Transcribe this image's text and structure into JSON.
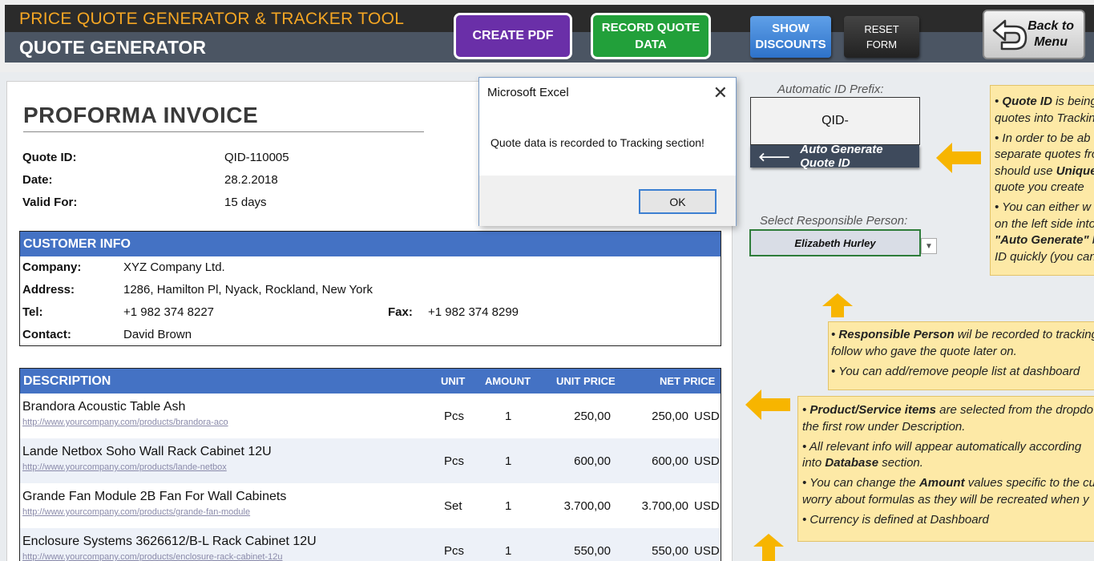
{
  "header": {
    "app_title": "PRICE QUOTE GENERATOR & TRACKER TOOL",
    "page_title": "QUOTE GENERATOR",
    "create_pdf": "CREATE PDF",
    "record_line1": "RECORD QUOTE",
    "record_line2": "DATA",
    "discounts_line1": "SHOW",
    "discounts_line2": "DISCOUNTS",
    "reset_line1": "RESET",
    "reset_line2": "FORM",
    "back_line1": "Back to",
    "back_line2": "Menu"
  },
  "invoice": {
    "title": "PROFORMA INVOICE",
    "meta": [
      {
        "label": "Quote ID:",
        "value": "QID-110005"
      },
      {
        "label": "Date:",
        "value": "28.2.2018"
      },
      {
        "label": "Valid For:",
        "value": "15 days"
      }
    ],
    "customer": {
      "heading": "CUSTOMER INFO",
      "company_label": "Company:",
      "company": "XYZ Company Ltd.",
      "address_label": "Address:",
      "address": "1286, Hamilton Pl, Nyack, Rockland, New York",
      "tel_label": "Tel:",
      "tel": "+1 982 374 8227",
      "fax_label": "Fax:",
      "fax": "+1 982 374 8299",
      "contact_label": "Contact:",
      "contact": "David Brown"
    },
    "items_header": {
      "description": "DESCRIPTION",
      "unit": "UNIT",
      "amount": "AMOUNT",
      "unit_price": "UNIT PRICE",
      "net_price": "NET PRICE"
    },
    "items": [
      {
        "name": "Brandora Acoustic Table Ash",
        "link": "http://www.yourcompany.com/products/brandora-aco",
        "unit": "Pcs",
        "amount": "1",
        "unit_price": "250,00",
        "net_price": "250,00",
        "currency": "USD"
      },
      {
        "name": "Lande Netbox Soho Wall Rack Cabinet 12U",
        "link": "http://www.yourcompany.com/products/lande-netbox",
        "unit": "Pcs",
        "amount": "1",
        "unit_price": "600,00",
        "net_price": "600,00",
        "currency": "USD"
      },
      {
        "name": "Grande Fan Module 2B Fan For Wall Cabinets",
        "link": "http://www.yourcompany.com/products/grande-fan-module",
        "unit": "Set",
        "amount": "1",
        "unit_price": "3.700,00",
        "net_price": "3.700,00",
        "currency": "USD"
      },
      {
        "name": "Enclosure Systems 3626612/B-L Rack Cabinet 12U",
        "link": "http://www.yourcompany.com/products/enclosure-rack-cabinet-12u",
        "unit": "Pcs",
        "amount": "1",
        "unit_price": "550,00",
        "net_price": "550,00",
        "currency": "USD"
      }
    ]
  },
  "dialog": {
    "title": "Microsoft Excel",
    "message": "Quote data is recorded to Tracking section!",
    "ok": "OK"
  },
  "side": {
    "prefix_label": "Automatic ID Prefix:",
    "prefix_value": "QID-",
    "auto_generate": "Auto Generate Quote ID",
    "person_label": "Select Responsible Person:",
    "person_value": "Elizabeth Hurley",
    "note1": {
      "l1_bold": "Quote ID",
      "l1_rest": " is being",
      "l2": "quotes into Trackin",
      "l3": "In order to be ab",
      "l4": "separate quotes fro",
      "l5_pre": "should use ",
      "l5_bold": "Unique",
      "l6": "quote you create",
      "l7": "You can either w",
      "l8": "on the left side into",
      "l9_bold": "\"Auto Generate\"",
      "l9_rest": " b",
      "l10": "ID quickly (you can"
    },
    "note2": {
      "l1_bold": "Responsible Person",
      "l1_rest": " wil be recorded to tracking",
      "l2": "follow who gave the quote later on.",
      "l3": "You can add/remove people list at dashboard"
    },
    "note3": {
      "l1_bold": "Product/Service items",
      "l1_rest": " are selected from the dropdo",
      "l2": "the first row under Description.",
      "l3": "All relevant info will appear automatically according",
      "l4_pre": "into ",
      "l4_bold": "Database",
      "l4_rest": " section.",
      "l5_pre": "You can change the ",
      "l5_bold": "Amount",
      "l5_rest": " values specific to the cu",
      "l6": "worry about formulas as they will be recreated when y",
      "l7": "Currency is defined at Dashboard"
    }
  },
  "colors": {
    "accent_blue": "#4472c4",
    "title_orange": "#f5a623",
    "note_yellow": "#fde9a6",
    "arrow_yellow": "#f7b500"
  }
}
